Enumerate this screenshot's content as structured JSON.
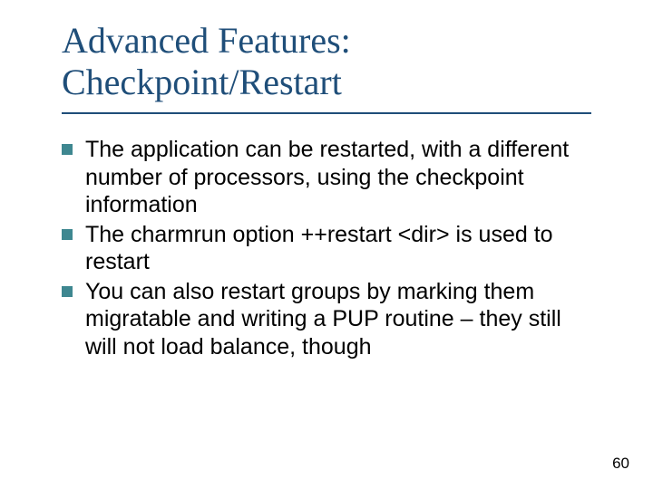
{
  "title_line1": "Advanced Features:",
  "title_line2": "Checkpoint/Restart",
  "bullets": [
    "The application can be restarted, with a different number of processors, using the checkpoint information",
    "The charmrun option ++restart <dir> is used to restart",
    "You can also restart groups by marking them migratable and writing a PUP routine – they still will not load balance, though"
  ],
  "page_number": "60",
  "colors": {
    "title": "#1f4e79",
    "bullet": "#3e8790"
  }
}
